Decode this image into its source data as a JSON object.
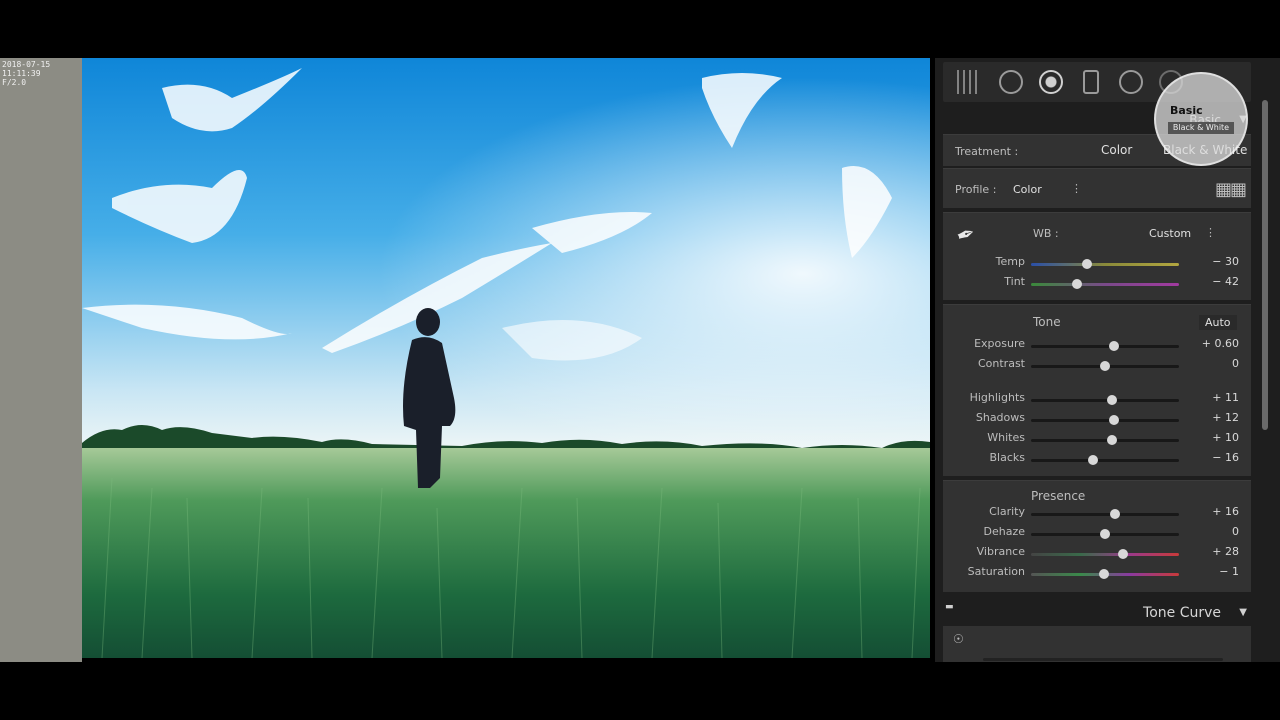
{
  "left_info": {
    "line1": "2018-07-15 11:11:39",
    "line2": "F/2.0"
  },
  "panel": {
    "header_title": "Basic",
    "treatment": {
      "label": "Treatment :",
      "option_color": "Color",
      "option_bw": "Black & White"
    },
    "profile": {
      "label": "Profile :",
      "value": "Color"
    },
    "wb": {
      "label": "WB :",
      "value": "Custom",
      "sliders": [
        {
          "label": "Temp",
          "value": "− 30",
          "pos": 0.38
        },
        {
          "label": "Tint",
          "value": "− 42",
          "pos": 0.31
        }
      ]
    },
    "tone": {
      "title": "Tone",
      "auto_label": "Auto",
      "sliders": [
        {
          "label": "Exposure",
          "value": "+ 0.60",
          "pos": 0.56
        },
        {
          "label": "Contrast",
          "value": "0",
          "pos": 0.5
        },
        {
          "label": "Highlights",
          "value": "+ 11",
          "pos": 0.55
        },
        {
          "label": "Shadows",
          "value": "+ 12",
          "pos": 0.56
        },
        {
          "label": "Whites",
          "value": "+ 10",
          "pos": 0.55
        },
        {
          "label": "Blacks",
          "value": "− 16",
          "pos": 0.42
        }
      ]
    },
    "presence": {
      "title": "Presence",
      "sliders": [
        {
          "label": "Clarity",
          "value": "+ 16",
          "pos": 0.57
        },
        {
          "label": "Dehaze",
          "value": "0",
          "pos": 0.5
        },
        {
          "label": "Vibrance",
          "value": "+ 28",
          "pos": 0.62
        },
        {
          "label": "Saturation",
          "value": "− 1",
          "pos": 0.49
        }
      ]
    },
    "tone_curve_title": "Tone Curve"
  },
  "colors": {
    "panel_bg": "#1e1e1e",
    "section_bg": "#323232",
    "accent_text": "#d6d6d6"
  }
}
